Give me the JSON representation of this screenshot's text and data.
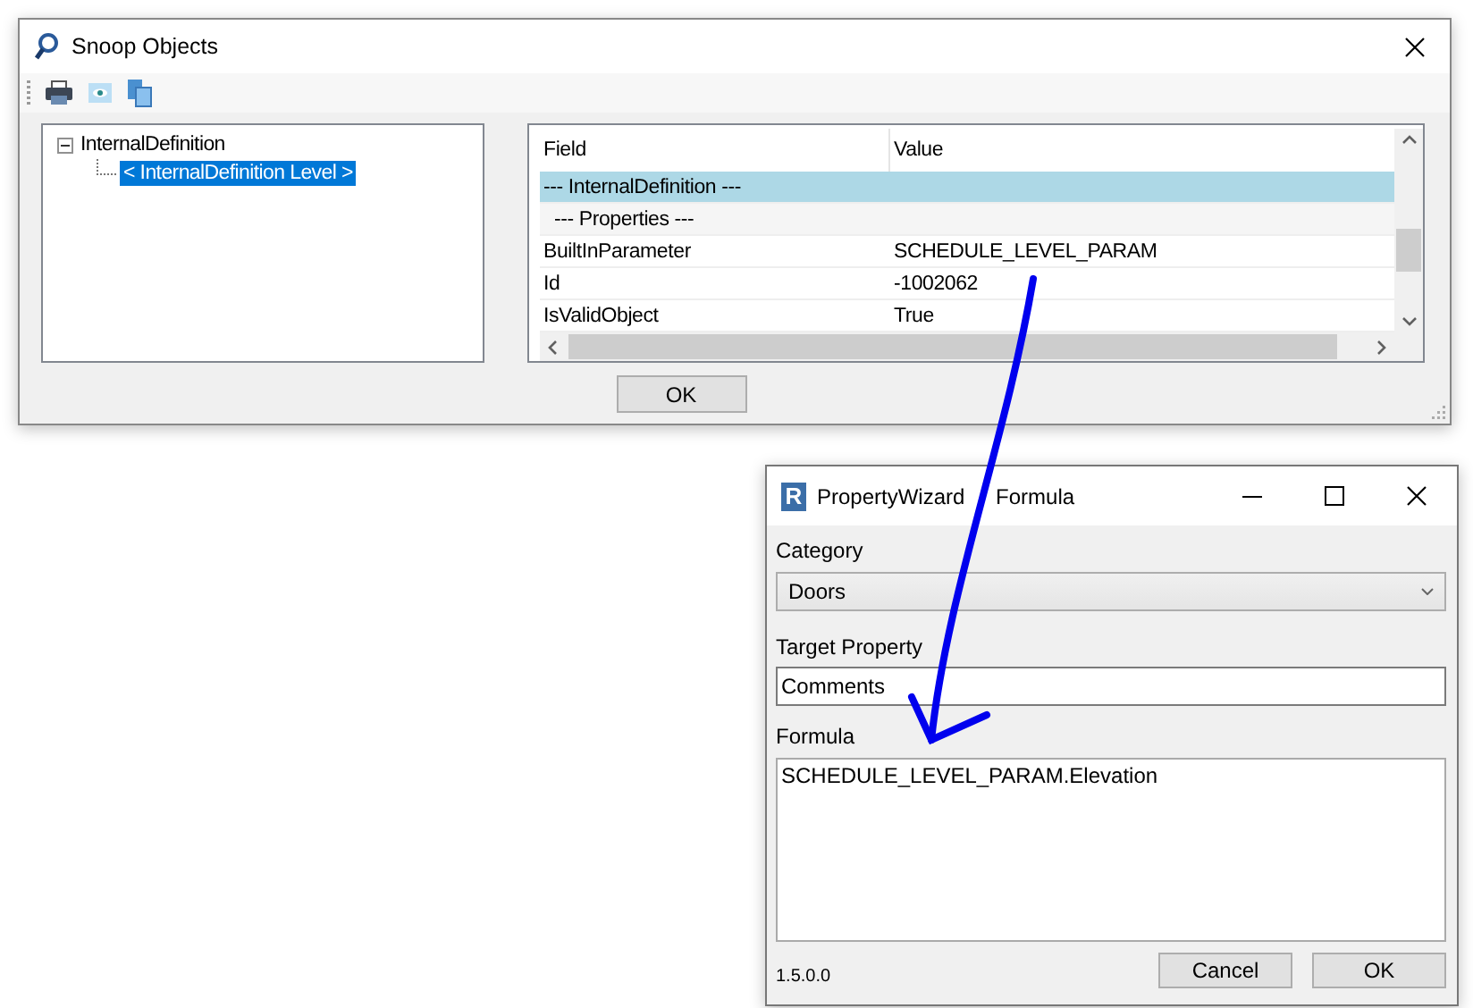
{
  "snoop": {
    "title": "Snoop Objects",
    "tree": [
      {
        "label": "InternalDefinition",
        "expanded": true,
        "selected": false,
        "children": [
          {
            "label": "< InternalDefinition  Level >",
            "selected": true
          }
        ]
      }
    ],
    "grid": {
      "columns": [
        "Field",
        "Value"
      ],
      "rows": [
        {
          "kind": "category",
          "label": "--- InternalDefinition ---",
          "selected": true
        },
        {
          "kind": "subcategory",
          "label": "--- Properties ---",
          "selected": false
        },
        {
          "kind": "property",
          "field": "BuiltInParameter",
          "value": "SCHEDULE_LEVEL_PARAM",
          "selected": false
        },
        {
          "kind": "property",
          "field": "Id",
          "value": "-1002062",
          "selected": false
        },
        {
          "kind": "property",
          "field": "IsValidObject",
          "value": "True",
          "selected": false
        }
      ]
    },
    "button": "OK"
  },
  "wizard": {
    "icon_letter": "R",
    "title": "PropertyWizard Formula",
    "category_label": "Category",
    "category": {
      "value": "Doors"
    },
    "target_label": "Target Property",
    "target": {
      "value": "Comments"
    },
    "formula_label": "Formula",
    "formula": {
      "value": "SCHEDULE_LEVEL_PARAM.Elevation"
    },
    "version": "1.5.0.0",
    "buttons": [
      "Cancel",
      "OK"
    ]
  }
}
